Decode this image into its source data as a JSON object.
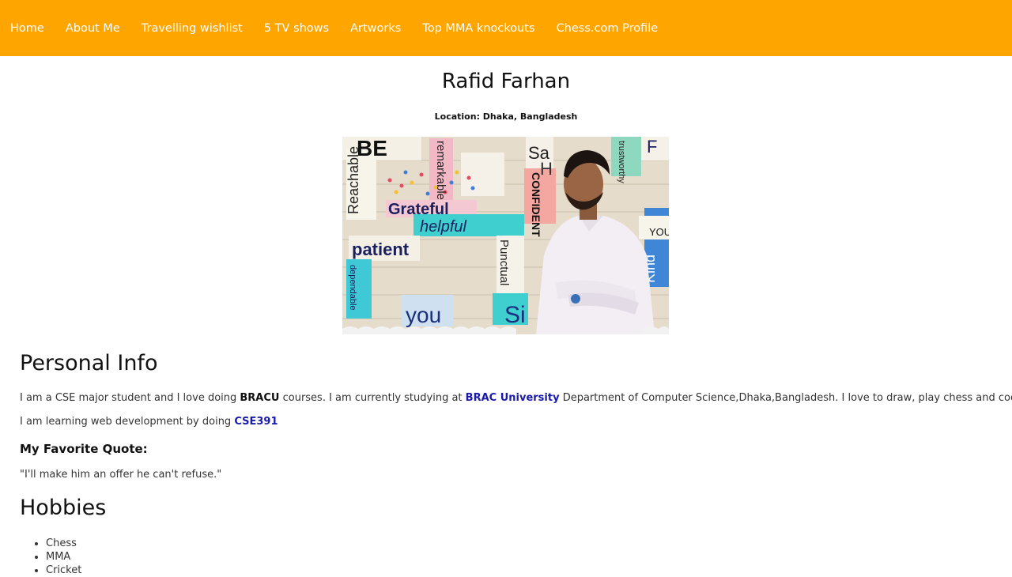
{
  "nav": {
    "items": [
      {
        "label": "Home"
      },
      {
        "label": "About Me"
      },
      {
        "label": "Travelling wishlist"
      },
      {
        "label": "5 TV shows"
      },
      {
        "label": "Artworks"
      },
      {
        "label": "Top MMA knockouts"
      },
      {
        "label": "Chess.com Profile"
      }
    ]
  },
  "profile": {
    "name": "Rafid Farhan",
    "location": "Location: Dhaka, Bangladesh"
  },
  "personal_info": {
    "heading": "Personal Info",
    "p1_a": "I am a CSE major student and I love doing ",
    "p1_bold": "BRACU",
    "p1_b": " courses. I am currently studying at ",
    "p1_link": "BRAC University",
    "p1_c": " Department of Computer Science,Dhaka,Bangladesh. I love to draw, play chess and code.",
    "p2_a": "I am learning web development by doing ",
    "p2_link": "CSE391",
    "quote_heading": "My Favorite Quote:",
    "quote": "\"I'll make him an offer he can't refuse.\""
  },
  "hobbies": {
    "heading": "Hobbies",
    "items": [
      "Chess",
      "MMA",
      "Cricket"
    ]
  },
  "photo_words": {
    "w1": "Reachable",
    "w2": "remarkable",
    "w3": "Grateful",
    "w4": "helpful",
    "w5": "patient",
    "w6": "you",
    "w7": "CONFIDENT",
    "w8": "Punctual",
    "w9": "Kind",
    "w10": "YOU CAN",
    "w11": "Si",
    "w12": "Sa",
    "w13": "BE",
    "w14": "trustworthy",
    "w15": "dependable",
    "w16": "H",
    "w17": "F"
  },
  "colors": {
    "navbar": "#ffa500",
    "link": "#1a1aaa"
  }
}
